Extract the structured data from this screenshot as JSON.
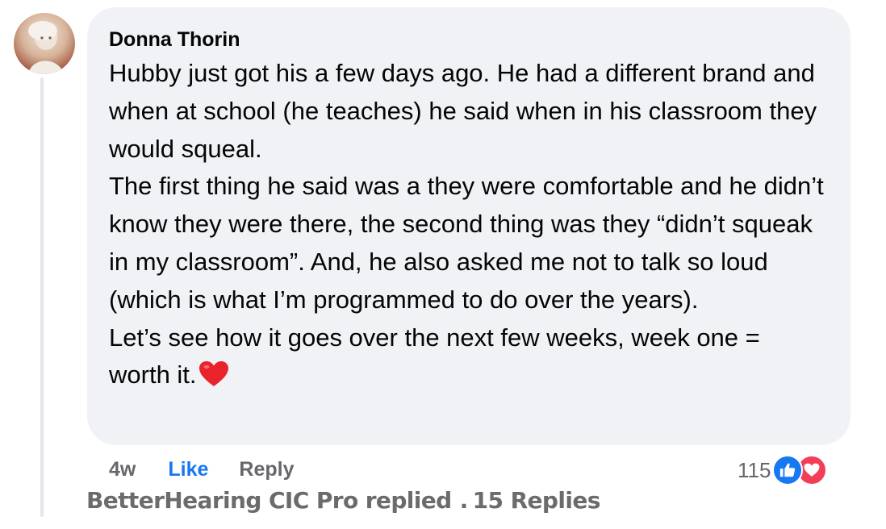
{
  "comment": {
    "author": "Donna Thorin",
    "paragraphs": [
      "Hubby just got his a few days ago. He had a different brand and when at school (he teaches) he said when in his classroom they would squeal.",
      "The first thing he said was a they were comfortable and he didn’t know they were there, the second thing was they “didn’t squeak in my classroom”. And, he also asked me not to talk so loud (which is what I’m programmed to do over the years).",
      "Let’s see how it goes over the next few weeks, week one = worth it."
    ],
    "emoji": "red-heart",
    "timestamp": "4w",
    "like_label": "Like",
    "reply_label": "Reply",
    "reaction_count": "115",
    "reactions": [
      "like-icon",
      "love-icon"
    ]
  },
  "replies": {
    "replier": "BetterHearing CIC Pro replied",
    "separator": ".",
    "count_label": "15 Replies"
  },
  "colors": {
    "bubble": "#f0f2f5",
    "text": "#050505",
    "muted": "#65676b",
    "link": "#1877f2",
    "love": "#f33e58"
  }
}
